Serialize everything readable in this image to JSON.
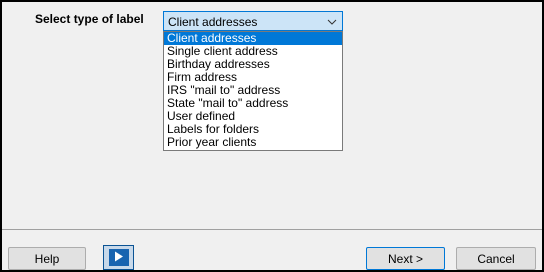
{
  "form": {
    "label_type_prompt": "Select type of label",
    "label_type": {
      "selected_value": "Client addresses",
      "options": [
        "Client addresses",
        "Single client address",
        "Birthday addresses",
        "Firm address",
        "IRS \"mail to\" address",
        "State \"mail to\" address",
        "User defined",
        "Labels for folders",
        "Prior year clients"
      ]
    }
  },
  "footer": {
    "help_label": "Help",
    "play_icon": "play-icon",
    "next_label": "Next >",
    "cancel_label": "Cancel"
  },
  "colors": {
    "accent": "#0078d7",
    "play_button": "#1864b0"
  }
}
